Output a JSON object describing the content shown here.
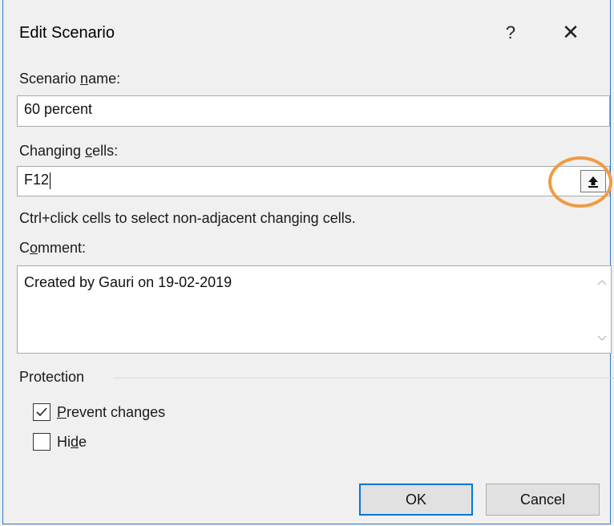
{
  "dialog": {
    "title": "Edit Scenario",
    "help_label": "?",
    "close_label": "✕"
  },
  "scenario_name": {
    "label_pre": "Scenario ",
    "label_underlined": "n",
    "label_post": "ame:",
    "value": "60 percent"
  },
  "changing_cells": {
    "label_pre": "Changing ",
    "label_underlined": "c",
    "label_post": "ells:",
    "value": "F12",
    "collapse_icon": "collapse-dialog-arrow-icon",
    "hint": "Ctrl+click cells to select non-adjacent changing cells."
  },
  "comment": {
    "label_pre": "C",
    "label_underlined": "o",
    "label_post": "mment:",
    "value": "Created by Gauri on 19-02-2019"
  },
  "protection": {
    "group_label": "Protection",
    "prevent_changes": {
      "label_underlined": "P",
      "label_post": "revent changes",
      "checked": true
    },
    "hide": {
      "label_pre": "Hi",
      "label_underlined": "d",
      "label_post": "e",
      "checked": false
    }
  },
  "buttons": {
    "ok": "OK",
    "cancel": "Cancel"
  },
  "colors": {
    "accent": "#0078d7",
    "annotation_ring": "#ef9b43",
    "window_border": "#2b78c5"
  }
}
